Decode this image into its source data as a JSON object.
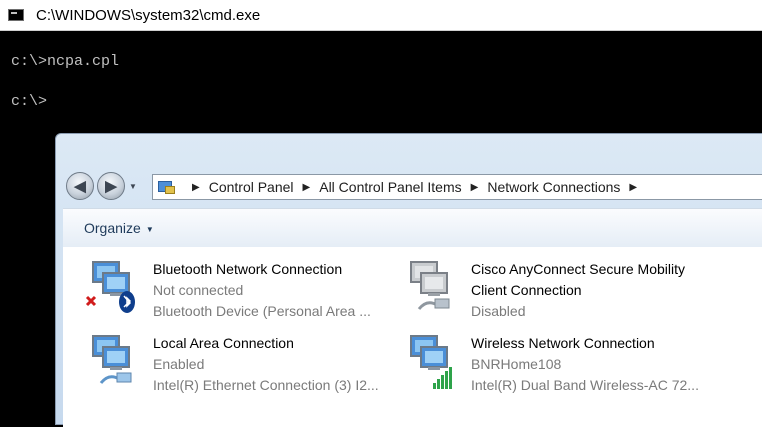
{
  "cmd": {
    "title": "C:\\WINDOWS\\system32\\cmd.exe",
    "lines": [
      "c:\\>ncpa.cpl",
      "c:\\>"
    ]
  },
  "explorer": {
    "breadcrumbs": [
      "Control Panel",
      "All Control Panel Items",
      "Network Connections"
    ],
    "toolbar": {
      "organize_label": "Organize"
    },
    "connections": [
      {
        "name": "Bluetooth Network Connection",
        "status": "Not connected",
        "device": "Bluetooth Device (Personal Area ...",
        "icon": "bluetooth-network-icon"
      },
      {
        "name": "Cisco AnyConnect Secure Mobility",
        "name2": "Client Connection",
        "status": "Disabled",
        "icon": "vpn-network-icon"
      },
      {
        "name": "Local Area Connection",
        "status": "Enabled",
        "device": "Intel(R) Ethernet Connection (3) I2...",
        "icon": "ethernet-network-icon"
      },
      {
        "name": "Wireless Network Connection",
        "status": "BNRHome108",
        "device": "Intel(R) Dual Band Wireless-AC 72...",
        "icon": "wireless-network-icon"
      }
    ]
  }
}
